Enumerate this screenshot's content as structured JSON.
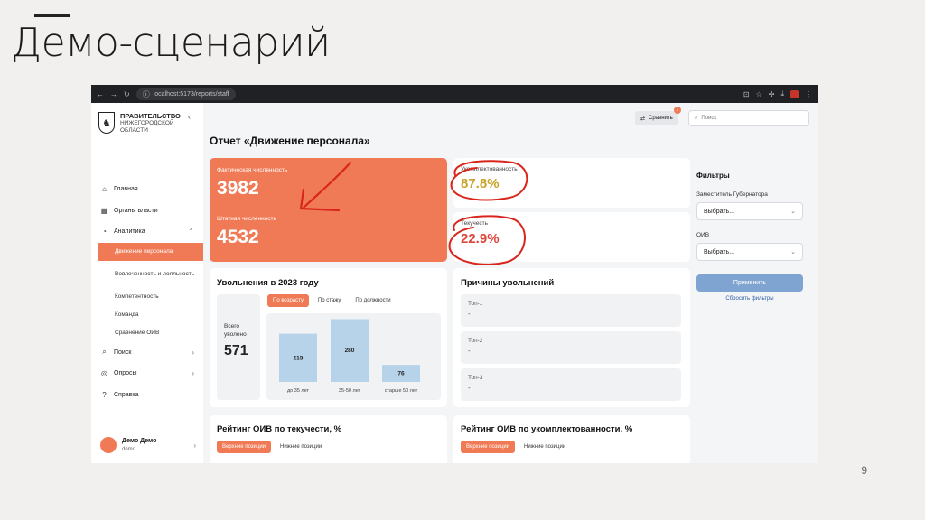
{
  "slide": {
    "title": "Демо-сценарий",
    "page_number": "9"
  },
  "browser": {
    "url": "localhost:5173/reports/staff"
  },
  "sidebar": {
    "logo": {
      "line1": "ПРАВИТЕЛЬСТВО",
      "line2": "НИЖЕГОРОДСКОЙ",
      "line3": "ОБЛАСТИ"
    },
    "items": [
      {
        "label": "Главная"
      },
      {
        "label": "Органы власти"
      },
      {
        "label": "Аналитика"
      },
      {
        "label": "Поиск"
      },
      {
        "label": "Опросы"
      },
      {
        "label": "Справка"
      }
    ],
    "subitems": [
      {
        "label": "Движение персонала"
      },
      {
        "label": "Вовлеченность и лояльность"
      },
      {
        "label": "Компетентность"
      },
      {
        "label": "Команда"
      },
      {
        "label": "Сравнение ОИВ"
      }
    ],
    "user": {
      "name": "Демо Демо",
      "login": "demo"
    }
  },
  "topbar": {
    "compare_label": "Сравнить",
    "compare_count": "1",
    "search_placeholder": "Поиск"
  },
  "page": {
    "title": "Отчет «Движение персонала»"
  },
  "kpis": {
    "actual_label": "Фактическая численность",
    "actual_value": "3982",
    "staff_label": "Штатная численность",
    "staff_value": "4532",
    "staffing_label": "Укомплектованность",
    "staffing_value": "87.8%",
    "turnover_label": "Текучесть",
    "turnover_value": "22.9%"
  },
  "colors": {
    "accent": "#f07a55",
    "staffing": "#c9a227",
    "turnover": "#e0453a",
    "bar": "#b7d3ea",
    "annotation": "#d9261c"
  },
  "dismissals": {
    "title": "Увольнения в 2023 году",
    "tabs": [
      "По возрасту",
      "По стажу",
      "По должности"
    ],
    "total_label_1": "Всего",
    "total_label_2": "уволено",
    "total_value": "571"
  },
  "chart_data": {
    "type": "bar",
    "categories": [
      "до 35 лет",
      "35-50 лет",
      "старше 50 лет"
    ],
    "values": [
      215,
      280,
      76
    ]
  },
  "reasons": {
    "title": "Причины увольнений",
    "items": [
      {
        "label": "Топ-1",
        "value": "-"
      },
      {
        "label": "Топ-2",
        "value": "-"
      },
      {
        "label": "Топ-3",
        "value": "-"
      }
    ]
  },
  "rating_turnover": {
    "title": "Рейтинг ОИВ по текучести, %",
    "tabs": [
      "Верхние позиции",
      "Нижние позиции"
    ]
  },
  "rating_staffing": {
    "title": "Рейтинг ОИВ по укомплектованности, %",
    "tabs": [
      "Верхние позиции",
      "Нижние позиции"
    ]
  },
  "filters": {
    "title": "Фильтры",
    "deputy_label": "Заместитель Губернатора",
    "deputy_value": "Выбрать...",
    "oiv_label": "ОИВ",
    "oiv_value": "Выбрать...",
    "apply": "Применить",
    "reset": "Сбросить фильтры"
  }
}
